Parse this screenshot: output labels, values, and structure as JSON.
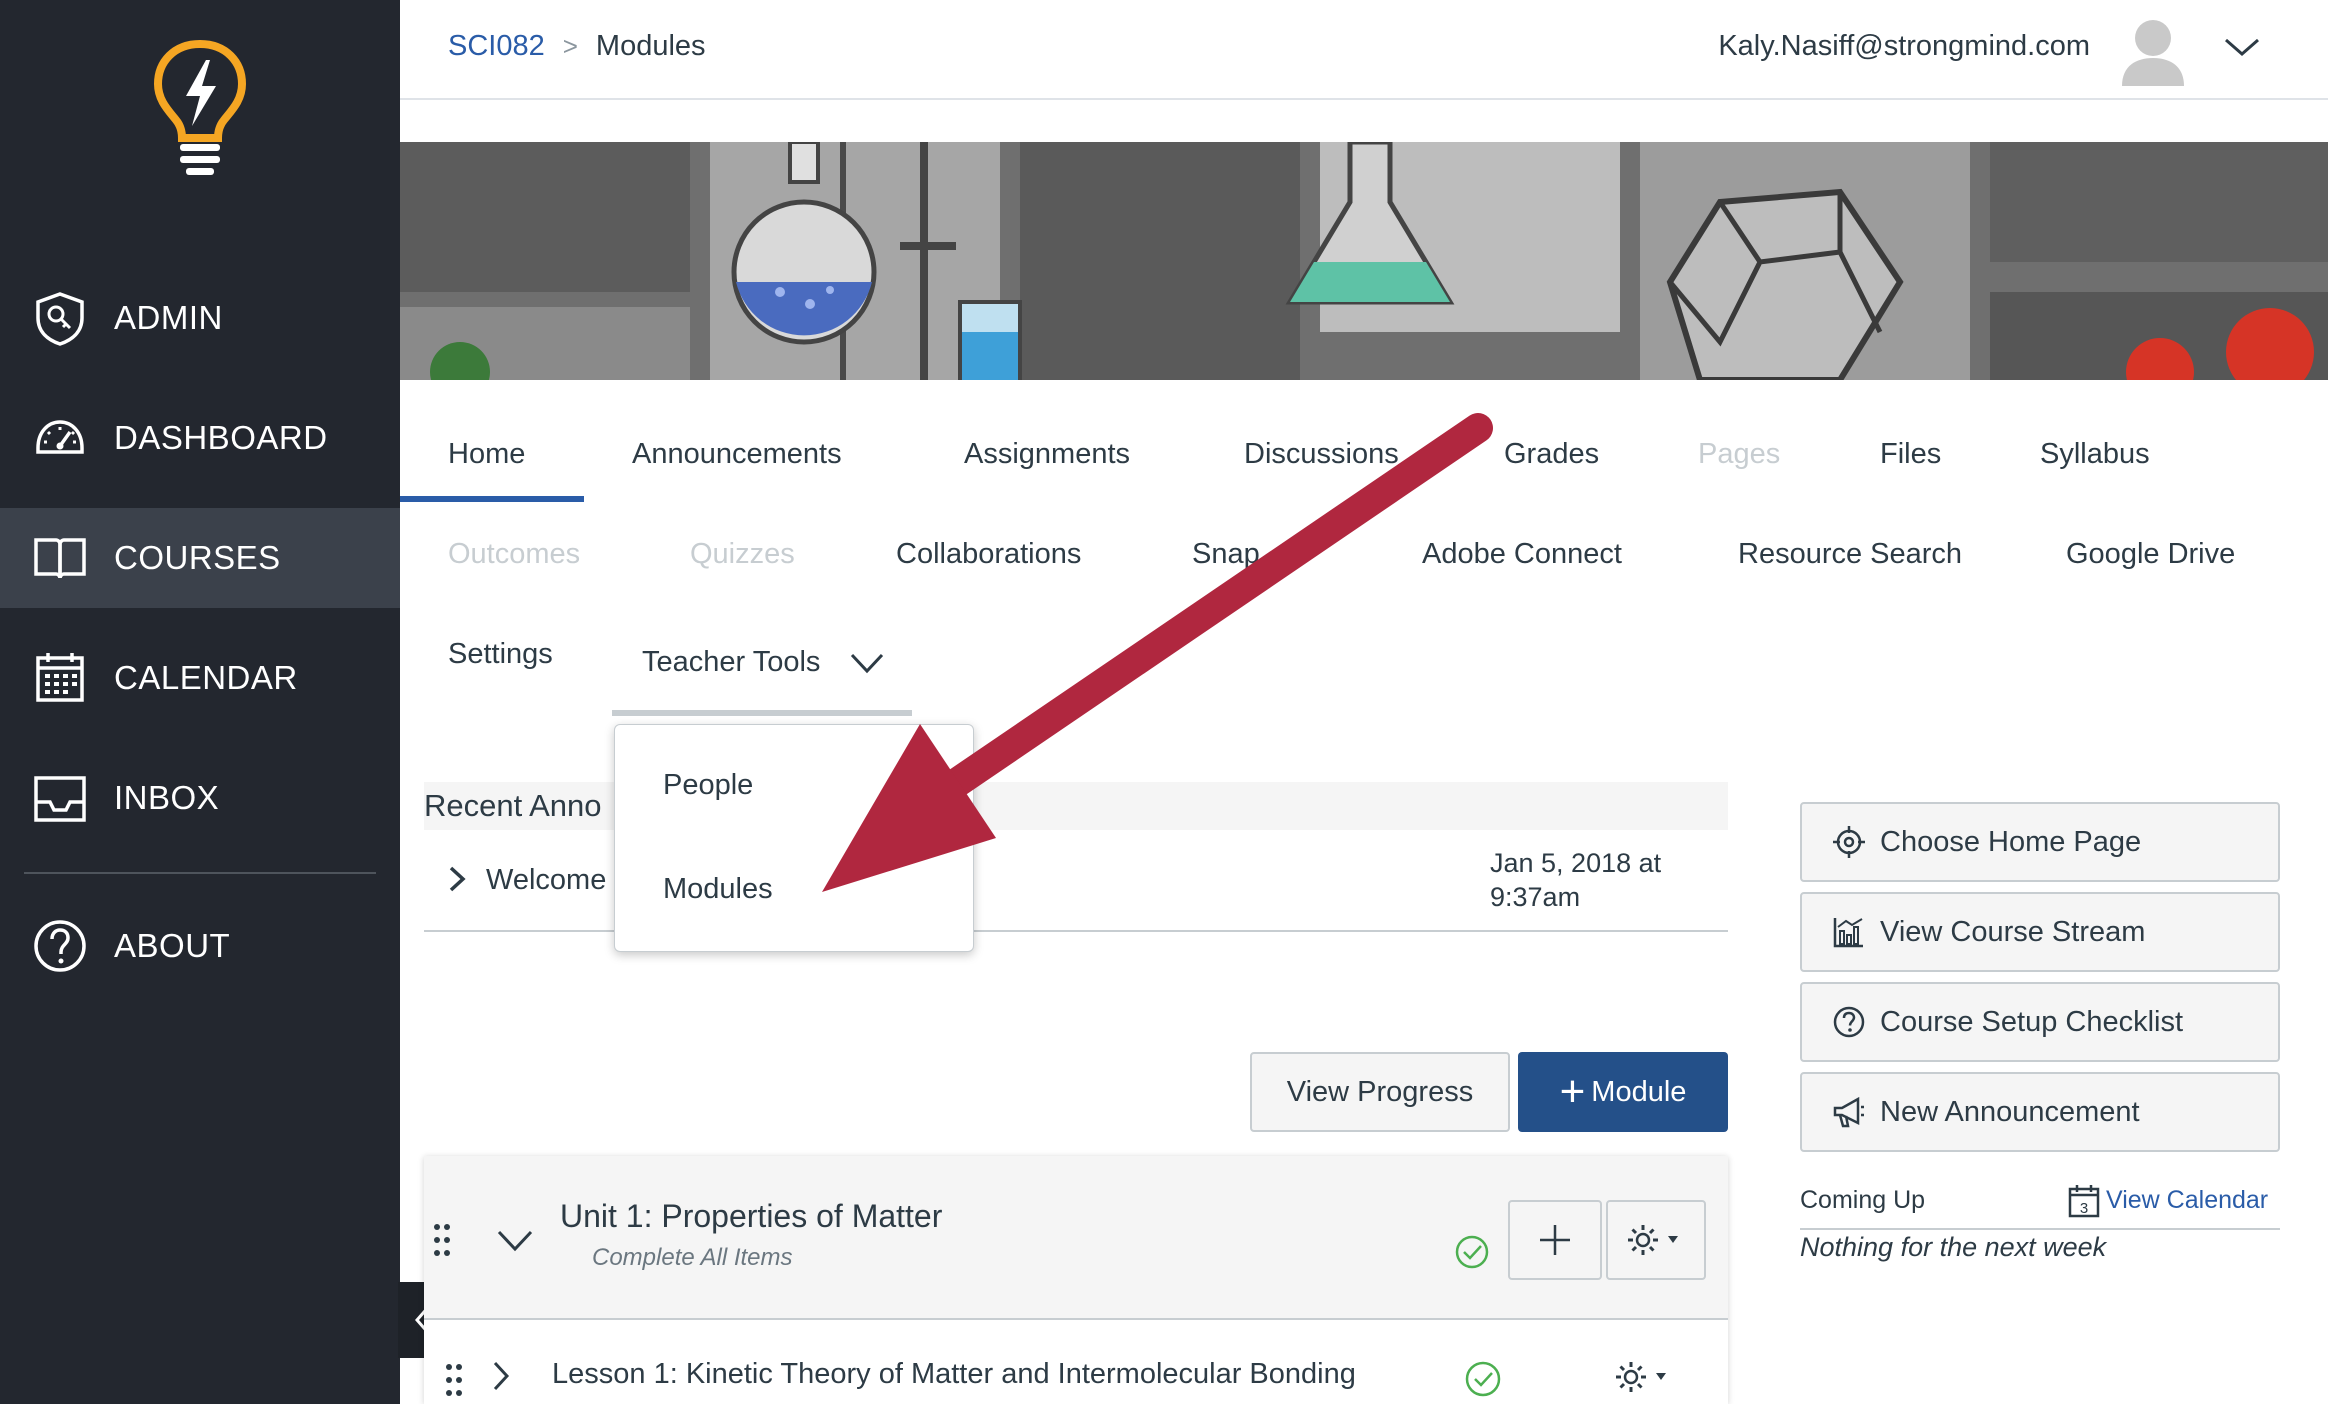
{
  "sidebar": {
    "items": [
      {
        "label": "ADMIN",
        "icon": "shield-icon"
      },
      {
        "label": "DASHBOARD",
        "icon": "speedometer-icon"
      },
      {
        "label": "COURSES",
        "icon": "book-icon"
      },
      {
        "label": "CALENDAR",
        "icon": "calendar-icon"
      },
      {
        "label": "INBOX",
        "icon": "inbox-icon"
      },
      {
        "label": "ABOUT",
        "icon": "question-circle-icon"
      }
    ],
    "active": "COURSES"
  },
  "header": {
    "breadcrumb_course": "SCI082",
    "breadcrumb_separator": ">",
    "breadcrumb_page": "Modules",
    "user_email": "Kaly.Nasiff@strongmind.com"
  },
  "course_nav": {
    "items": [
      {
        "label": "Home",
        "state": "active"
      },
      {
        "label": "Announcements",
        "state": "enabled"
      },
      {
        "label": "Assignments",
        "state": "enabled"
      },
      {
        "label": "Discussions",
        "state": "enabled"
      },
      {
        "label": "Grades",
        "state": "enabled"
      },
      {
        "label": "Pages",
        "state": "disabled"
      },
      {
        "label": "Files",
        "state": "enabled"
      },
      {
        "label": "Syllabus",
        "state": "enabled"
      },
      {
        "label": "Outcomes",
        "state": "disabled"
      },
      {
        "label": "Quizzes",
        "state": "disabled"
      },
      {
        "label": "Collaborations",
        "state": "enabled"
      },
      {
        "label": "Snap",
        "state": "enabled"
      },
      {
        "label": "Adobe Connect",
        "state": "enabled"
      },
      {
        "label": "Resource Search",
        "state": "enabled"
      },
      {
        "label": "Google Drive",
        "state": "enabled"
      },
      {
        "label": "Settings",
        "state": "enabled"
      },
      {
        "label": "Teacher Tools",
        "state": "open"
      }
    ]
  },
  "teacher_tools_menu": {
    "items": [
      "People",
      "Modules"
    ]
  },
  "announcements": {
    "title": "Recent Anno",
    "row_title": "Welcome",
    "row_date": "Jan 5, 2018 at 9:37am"
  },
  "actions": {
    "view_progress": "View Progress",
    "add_module": "Module",
    "add_module_prefix": "+"
  },
  "right_panel": {
    "buttons": [
      {
        "label": "Choose Home Page",
        "icon": "target-icon"
      },
      {
        "label": "View Course Stream",
        "icon": "bar-chart-icon"
      },
      {
        "label": "Course Setup Checklist",
        "icon": "question-circle-icon"
      },
      {
        "label": "New Announcement",
        "icon": "megaphone-icon"
      }
    ],
    "coming_up_label": "Coming Up",
    "view_calendar": "View Calendar",
    "calendar_day": "3",
    "coming_up_empty": "Nothing for the next week"
  },
  "module": {
    "title": "Unit 1: Properties of Matter",
    "requirement": "Complete All Items",
    "lesson_title": "Lesson 1: Kinetic Theory of Matter and Intermolecular Bonding"
  },
  "colors": {
    "sidebar_bg": "#23272f",
    "sidebar_active": "#3b414b",
    "link_blue": "#2a5ca8",
    "primary_button": "#245089",
    "annotation_arrow": "#b0273f",
    "success_green": "#4caf50",
    "logo_yellow": "#f5a623"
  }
}
